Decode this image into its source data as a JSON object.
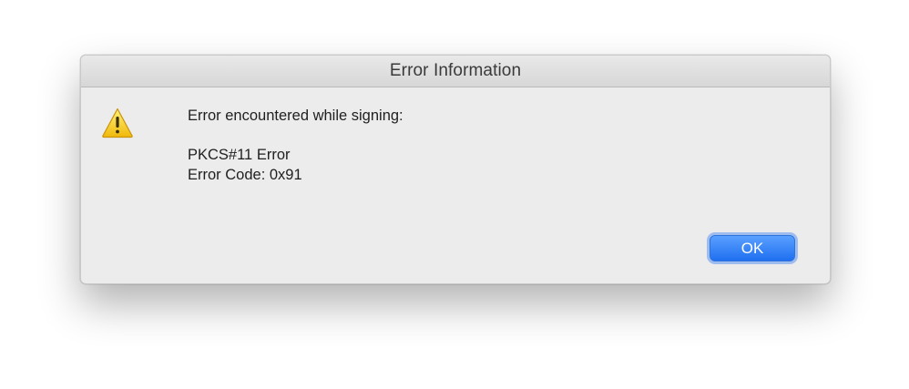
{
  "dialog": {
    "title": "Error Information",
    "message_header": "Error encountered while signing:",
    "message_lines": [
      "PKCS#11 Error",
      "Error Code: 0x91"
    ],
    "icon": "warning-icon",
    "ok_label": "OK"
  },
  "colors": {
    "accent": "#1f6ff0",
    "dialog_bg": "#ececec",
    "warning": "#f3c318"
  }
}
